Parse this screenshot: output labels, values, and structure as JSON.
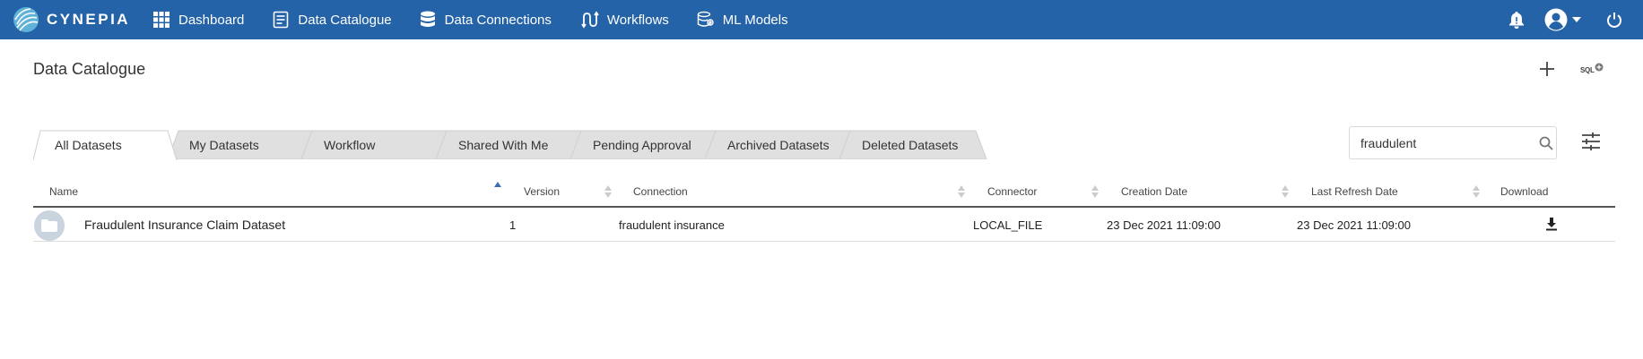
{
  "app": {
    "brand": "CYNEPIA",
    "colors": {
      "nav_bg": "#2563a8",
      "tab_active_bg": "#ffffff",
      "tab_inactive_bg": "#e0e0e0",
      "sort_active": "#3b6fb6"
    }
  },
  "nav": {
    "items": [
      {
        "label": "Dashboard",
        "icon": "grid-icon"
      },
      {
        "label": "Data Catalogue",
        "icon": "document-icon"
      },
      {
        "label": "Data Connections",
        "icon": "database-icon"
      },
      {
        "label": "Workflows",
        "icon": "workflow-icon"
      },
      {
        "label": "ML Models",
        "icon": "models-icon"
      }
    ],
    "right_icons": [
      "bell-icon",
      "account-icon",
      "chevron-down-icon",
      "power-icon"
    ]
  },
  "page": {
    "title": "Data Catalogue",
    "sql_label": "SQL"
  },
  "tabs": [
    {
      "label": "All Datasets",
      "active": true
    },
    {
      "label": "My Datasets",
      "active": false
    },
    {
      "label": "Workflow",
      "active": false
    },
    {
      "label": "Shared With Me",
      "active": false
    },
    {
      "label": "Pending Approval",
      "active": false
    },
    {
      "label": "Archived Datasets",
      "active": false
    },
    {
      "label": "Deleted Datasets",
      "active": false
    }
  ],
  "search": {
    "value": "fraudulent",
    "placeholder": ""
  },
  "table": {
    "columns": [
      "Name",
      "Version",
      "Connection",
      "Connector",
      "Creation Date",
      "Last Refresh Date",
      "Download"
    ],
    "rows": [
      {
        "name": "Fraudulent Insurance Claim Dataset",
        "version": "1",
        "connection": "fraudulent insurance",
        "connector": "LOCAL_FILE",
        "creation_date": "23 Dec 2021 11:09:00",
        "last_refresh_date": "23 Dec 2021 11:09:00",
        "download_icon": "download-icon"
      }
    ]
  }
}
